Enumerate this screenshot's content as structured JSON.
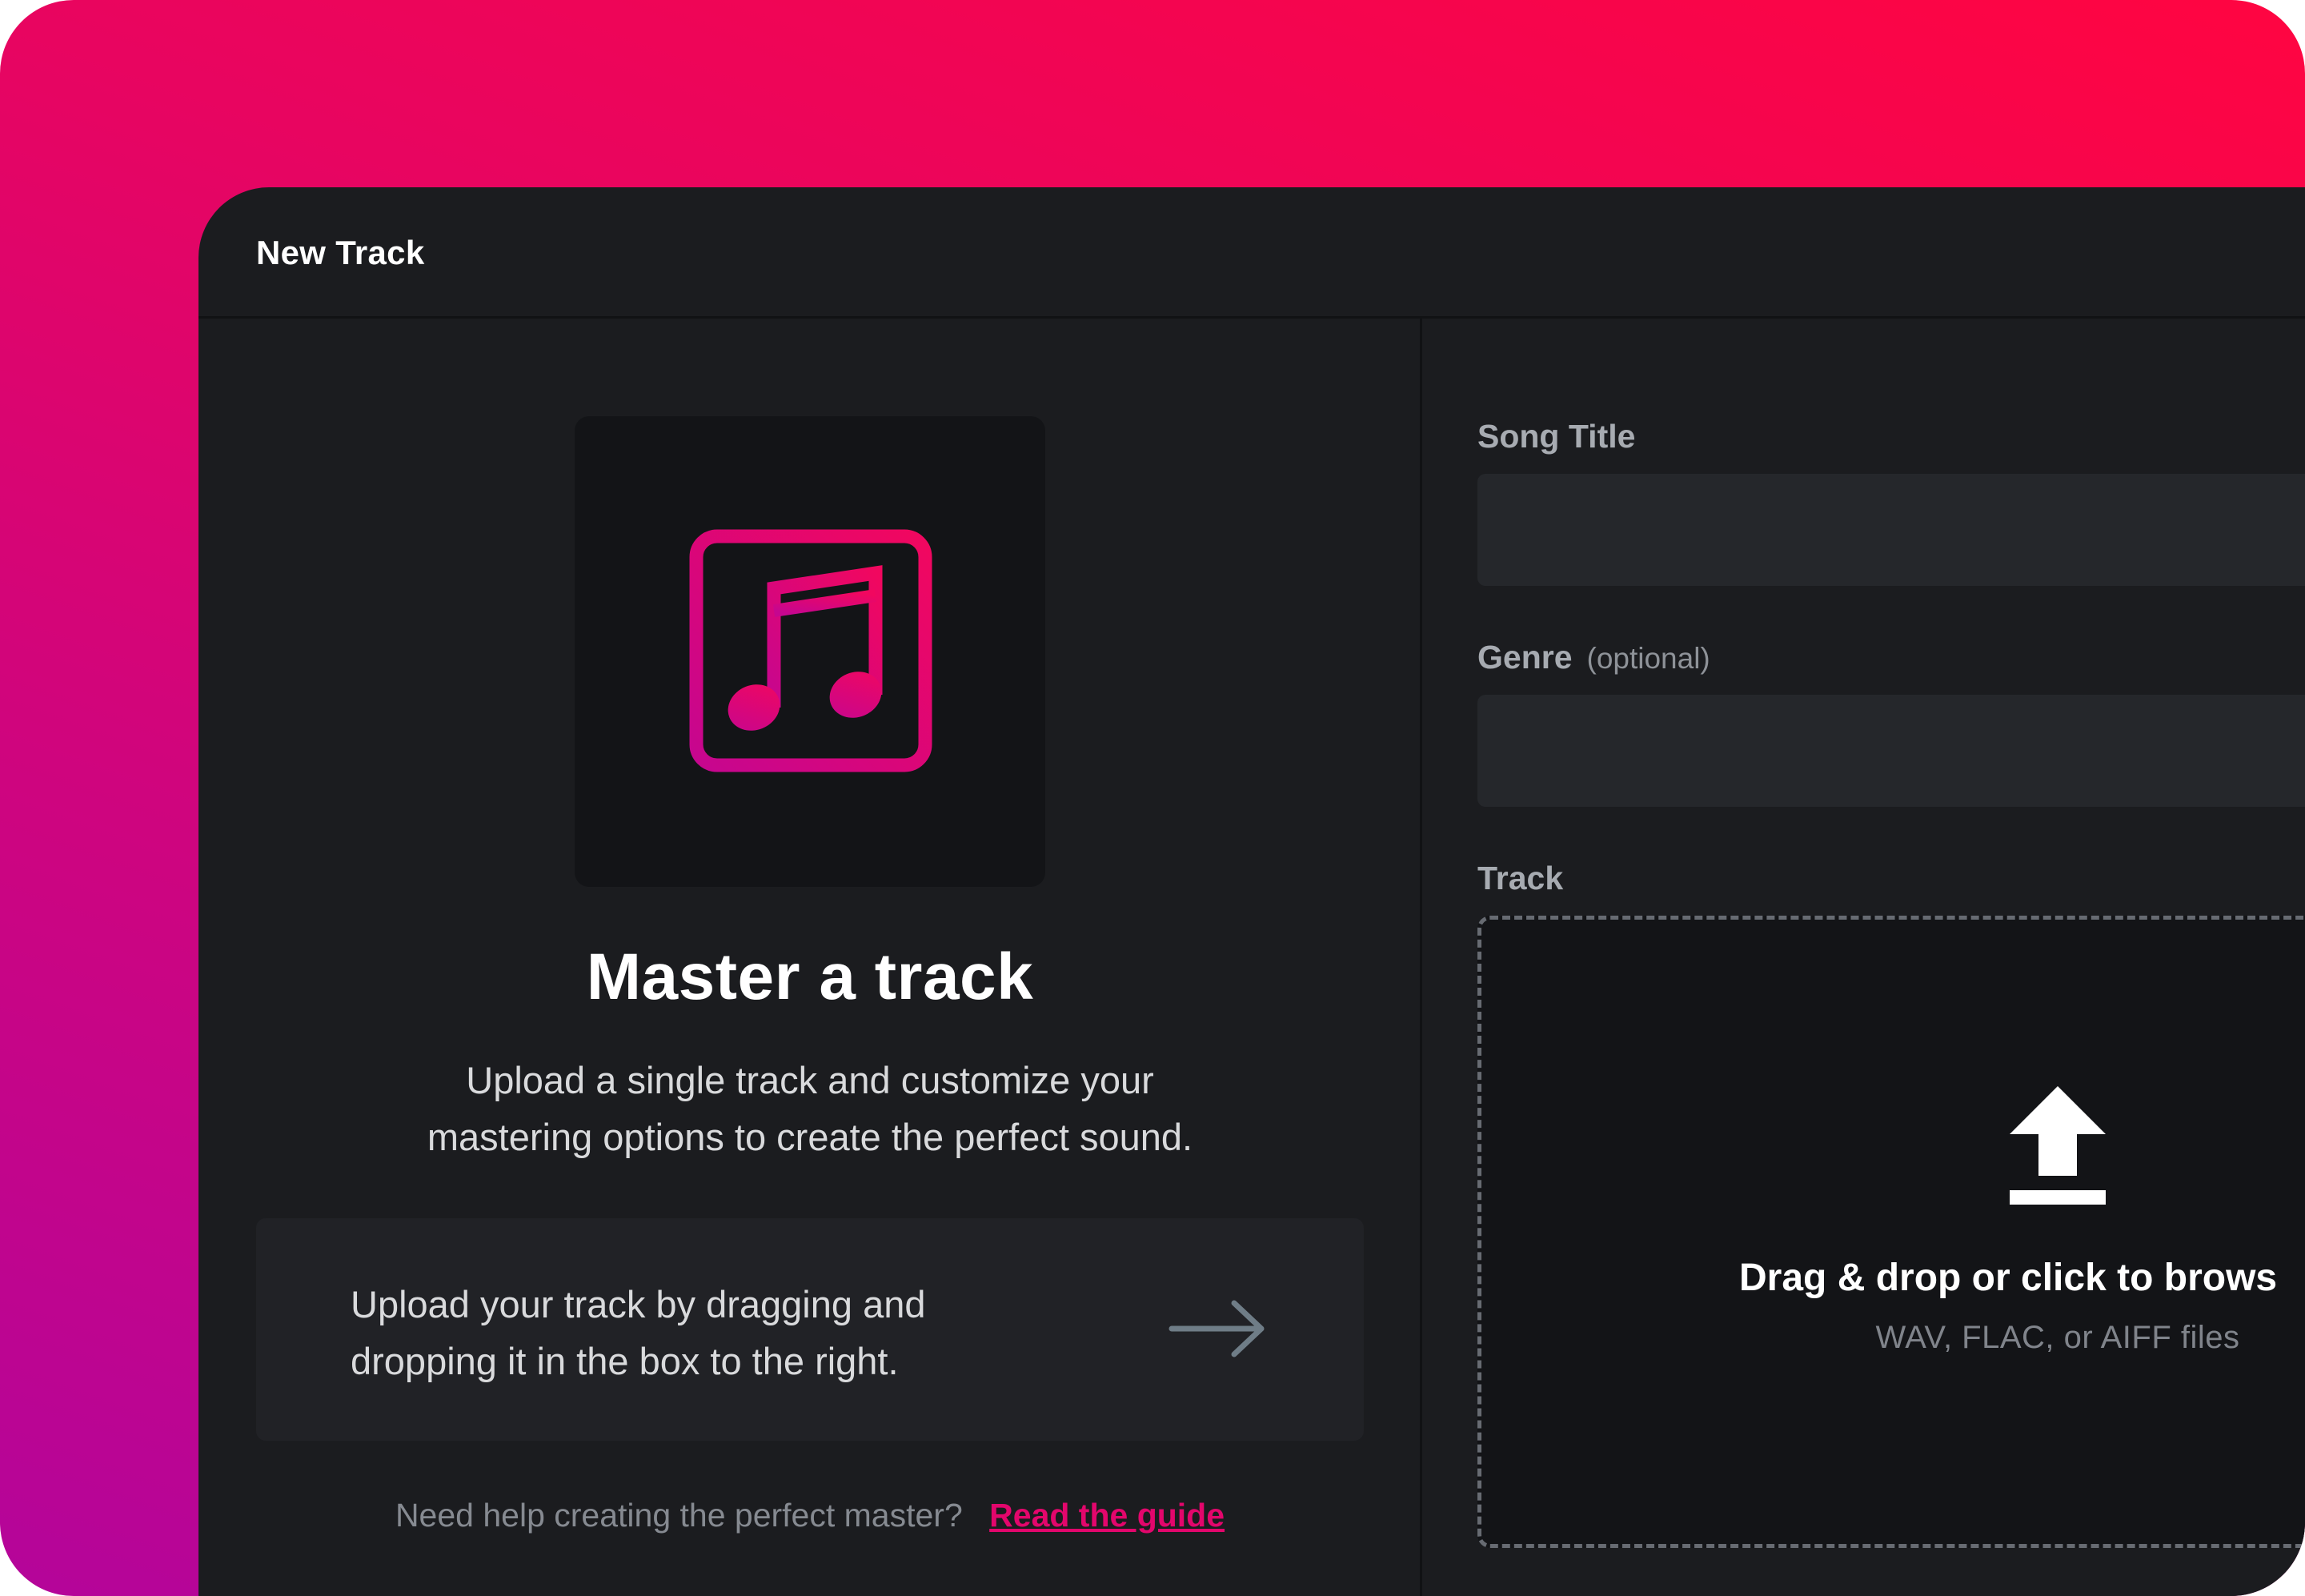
{
  "window": {
    "title": "New Track"
  },
  "left_panel": {
    "cover_icon": "music-note-square-icon",
    "heading": "Master a track",
    "description_lines": [
      "Upload a single track and customize your",
      "mastering options to create the perfect sound."
    ],
    "info_card": {
      "lines": [
        "Upload your track by dragging and",
        "dropping it in the box to the right."
      ],
      "icon": "arrow-right-icon"
    },
    "help": {
      "text": "Need help creating the perfect master?",
      "link_label": "Read the guide"
    }
  },
  "form": {
    "song_title": {
      "label": "Song Title",
      "value": "",
      "placeholder": ""
    },
    "genre": {
      "label": "Genre",
      "optional_label": "(optional)",
      "value": "",
      "placeholder": ""
    },
    "track": {
      "label": "Track",
      "dropzone": {
        "icon": "upload-arrow-icon",
        "title": "Drag & drop or click to brows",
        "subtitle": "WAV, FLAC, or AIFF files"
      }
    }
  },
  "colors": {
    "accent": "#e3066c",
    "background_gradient_start": "#ff0541",
    "background_gradient_end": "#b4059a",
    "window_bg": "#1b1c1f",
    "input_bg": "#25272b",
    "dropzone_bg": "#131417"
  }
}
